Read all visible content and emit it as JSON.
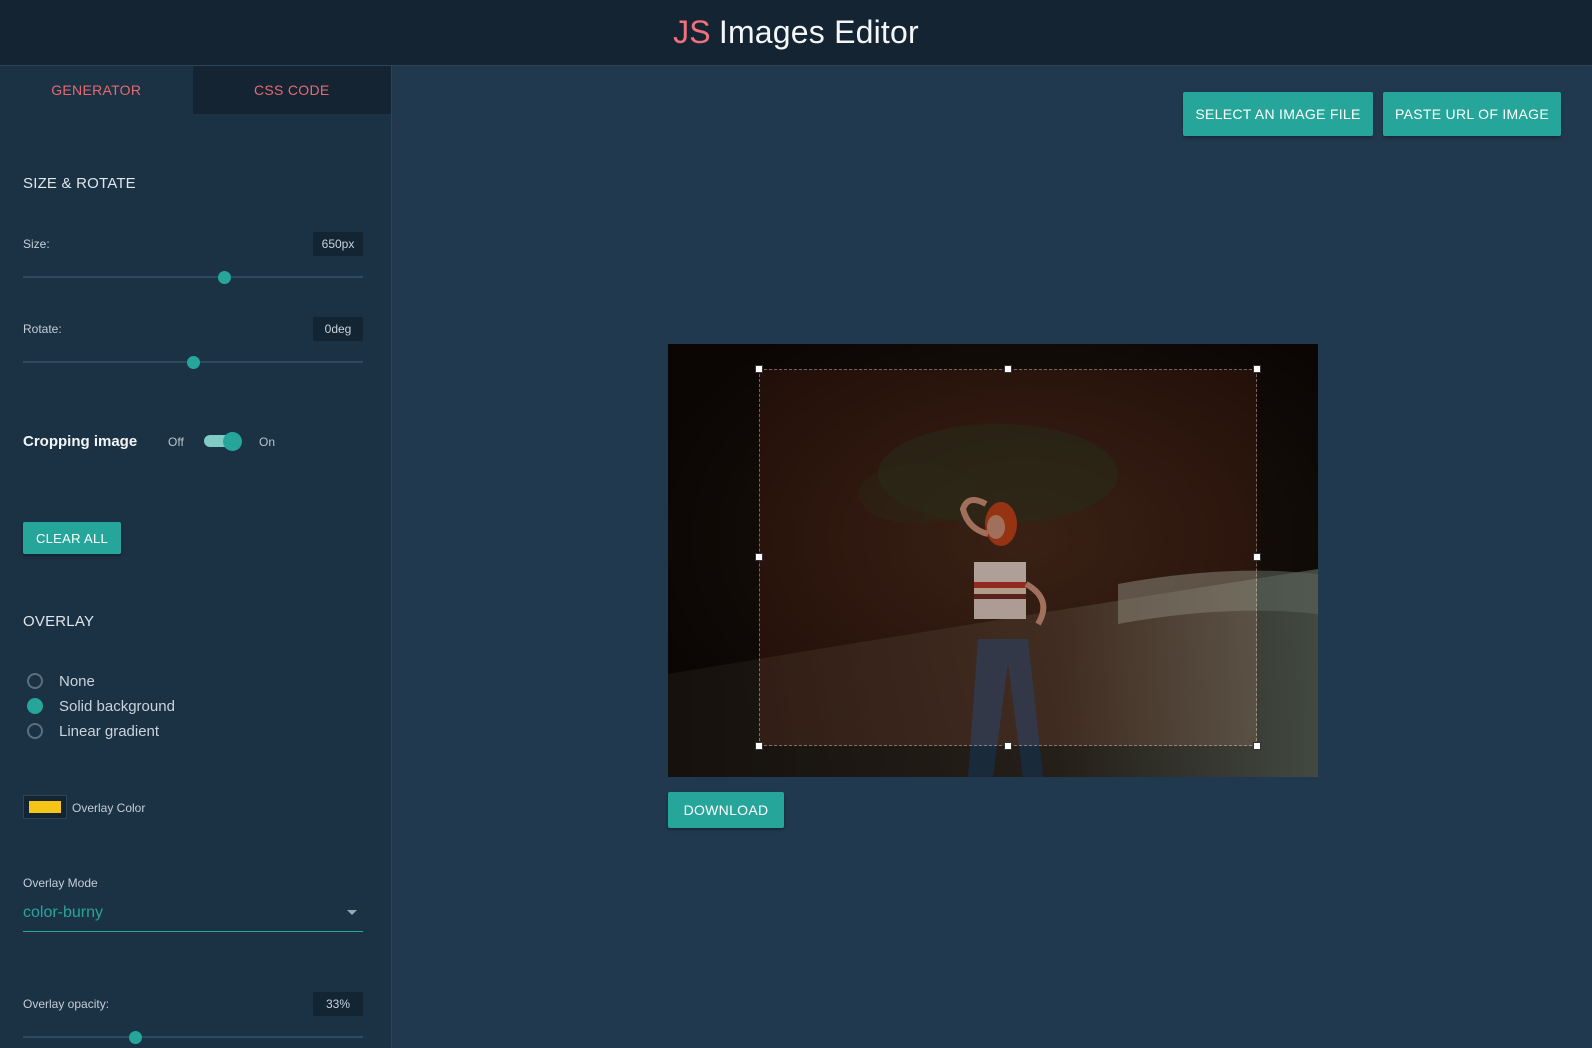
{
  "header": {
    "title_prefix": "JS",
    "title_rest": "Images Editor"
  },
  "tabs": [
    {
      "label": "GENERATOR",
      "active": true
    },
    {
      "label": "CSS CODE",
      "active": false
    }
  ],
  "size_rotate": {
    "title": "SIZE & ROTATE",
    "size_label": "Size:",
    "size_value": "650px",
    "size_slider_fraction": 0.59,
    "rotate_label": "Rotate:",
    "rotate_value": "0deg",
    "rotate_slider_fraction": 0.5
  },
  "cropping": {
    "label": "Cropping image",
    "off_label": "Off",
    "on_label": "On",
    "enabled": true
  },
  "clear_all_label": "CLEAR ALL",
  "overlay": {
    "title": "OVERLAY",
    "options": [
      {
        "label": "None",
        "checked": false
      },
      {
        "label": "Solid background",
        "checked": true
      },
      {
        "label": "Linear gradient",
        "checked": false
      }
    ],
    "color_label": "Overlay Color",
    "color": "#f5c518",
    "mode_label": "Overlay Mode",
    "mode_value": "color-burny",
    "opacity_label": "Overlay opacity:",
    "opacity_value": "33%",
    "opacity_slider_fraction": 0.33
  },
  "toolbar": {
    "select_file_label": "SELECT AN IMAGE FILE",
    "paste_url_label": "PASTE URL OF IMAGE"
  },
  "download_label": "DOWNLOAD",
  "colors": {
    "accent": "#26a69a",
    "brand_red": "#f0717a",
    "background": "#21394e",
    "sidebar": "#1b3144"
  },
  "icons": {
    "mode_caret": "caret-down-icon",
    "crop_handle": "crop-handle-icon"
  }
}
